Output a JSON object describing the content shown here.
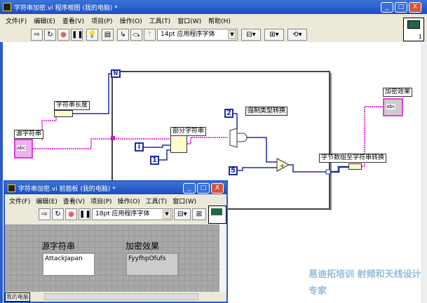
{
  "main_window": {
    "title": "字符串加密.vi 程序框图 (我的电脑) *",
    "menu": [
      "文件(F)",
      "编辑(E)",
      "查看(V)",
      "项目(P)",
      "操作(O)",
      "工具(T)",
      "窗口(W)",
      "帮助(H)"
    ],
    "font_select": "14pt 应用程序字体",
    "help_icon": "?",
    "connector_number": "1"
  },
  "diagram": {
    "source_string_label": "源字符串",
    "string_length_label": "字符串长度",
    "loop_count": "N",
    "loop_index": "i",
    "substring_label": "部分字符串",
    "const_1": "1",
    "const_2": "2",
    "const_5": "5",
    "typecast_label": "强制类型转换",
    "byte_to_string_label": "字节数组至字符串转换",
    "encrypted_label": "加密效果",
    "terminal_text": "abc"
  },
  "front_panel": {
    "title": "字符串加密.vi 前面板 (我的电脑) *",
    "menu": [
      "文件(F)",
      "编辑(E)",
      "查看(V)",
      "项目(P)",
      "操作(O)",
      "工具(T)",
      "窗口(W)"
    ],
    "font_select": "18pt 应用程序字体",
    "source_label": "源字符串",
    "source_value": "AttackJapan",
    "result_label": "加密效果",
    "result_value": "FyyfhpOfufs",
    "status_context": "我的电脑"
  },
  "watermark": "易迪拓培训 射频和天线设计专家"
}
